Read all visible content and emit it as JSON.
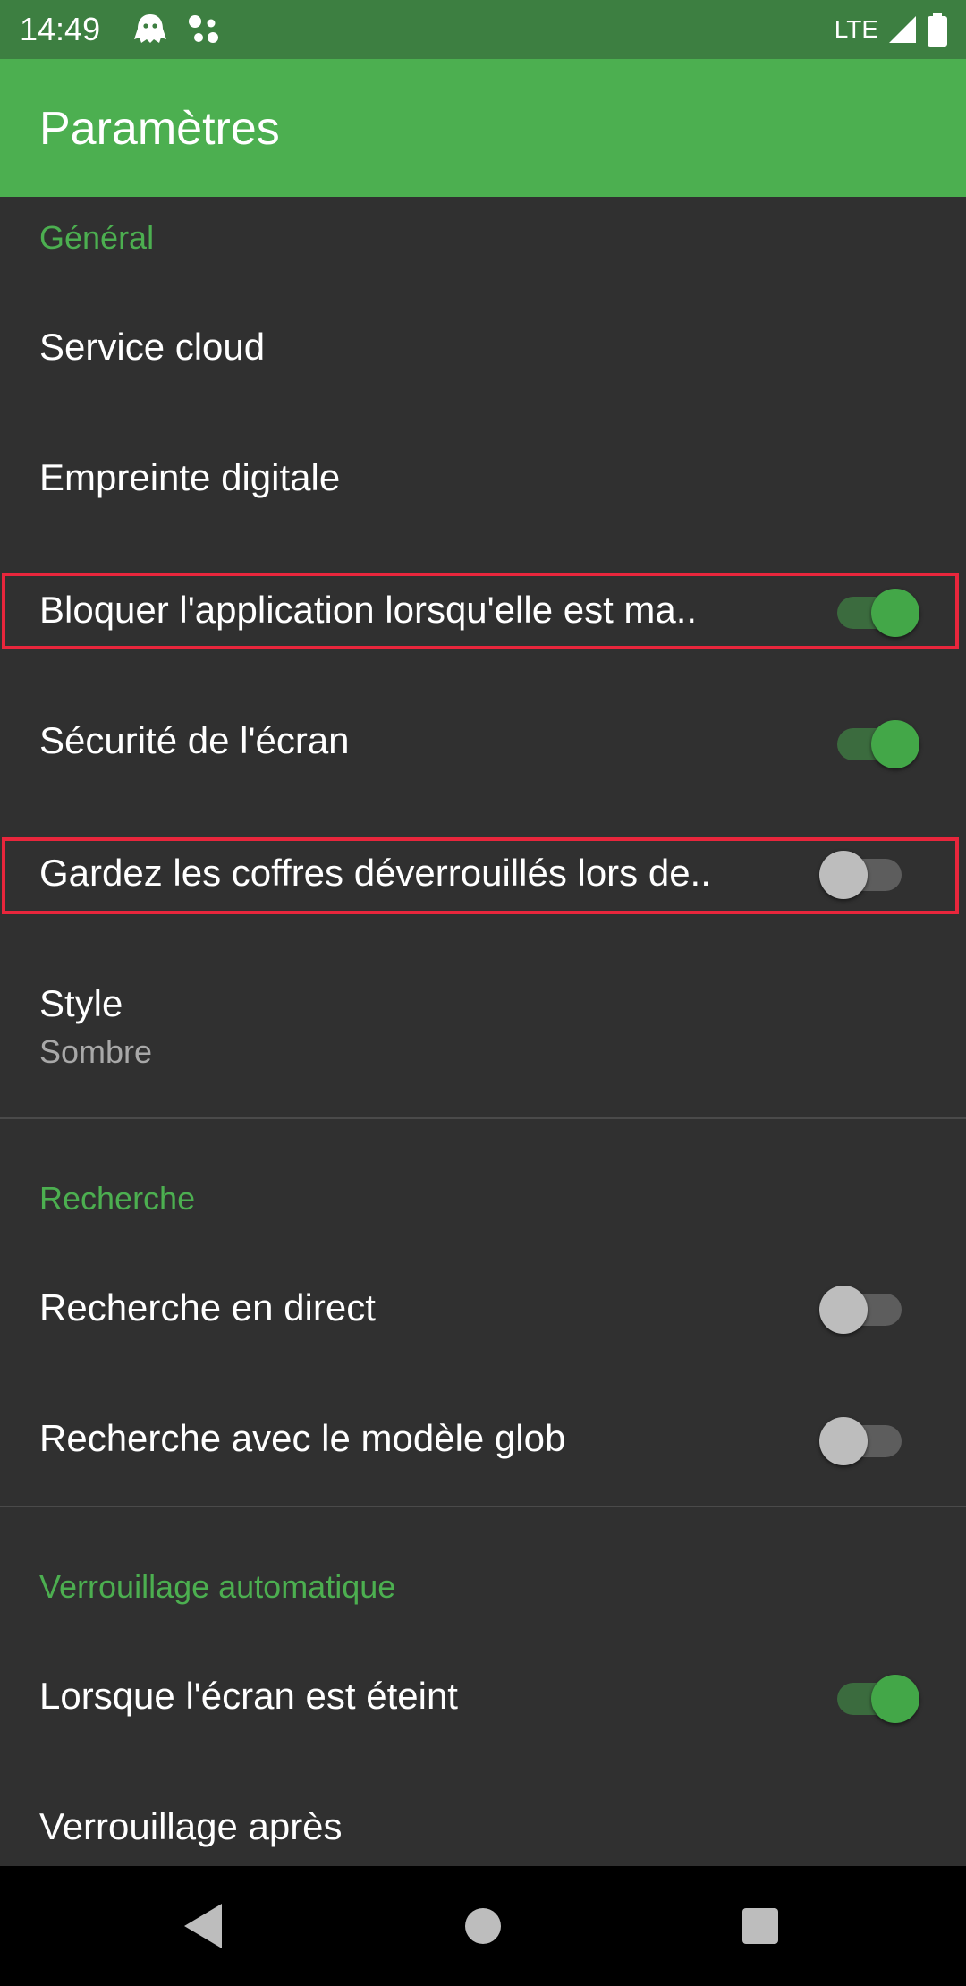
{
  "status_bar": {
    "time": "14:49",
    "network": "LTE",
    "icons": [
      "ghost-icon",
      "assistant-dots-icon",
      "signal-icon",
      "battery-icon"
    ]
  },
  "app_bar": {
    "title": "Paramètres"
  },
  "colors": {
    "accent": "#4caf50",
    "status_bar": "#3d7f41",
    "background": "#303030",
    "highlight": "#e8263c"
  },
  "sections": {
    "general": {
      "header": "Général",
      "items": {
        "cloud": {
          "title": "Service cloud"
        },
        "fingerprint": {
          "title": "Empreinte digitale"
        },
        "block_app": {
          "title": "Bloquer l'application lorsqu'elle est ma..",
          "enabled": true
        },
        "screen_security": {
          "title": "Sécurité de l'écran",
          "enabled": true
        },
        "keep_unlocked": {
          "title": "Gardez les coffres déverrouillés lors de..",
          "enabled": false
        },
        "style": {
          "title": "Style",
          "summary": "Sombre"
        }
      }
    },
    "search": {
      "header": "Recherche",
      "items": {
        "live_search": {
          "title": "Recherche en direct",
          "enabled": false
        },
        "glob_search": {
          "title": "Recherche avec le modèle glob",
          "enabled": false
        }
      }
    },
    "autolock": {
      "header": "Verrouillage automatique",
      "items": {
        "screen_off": {
          "title": "Lorsque l'écran est éteint",
          "enabled": true
        },
        "lock_after": {
          "title": "Verrouillage après"
        }
      }
    }
  },
  "nav_bar": {
    "buttons": [
      "back-icon",
      "home-icon",
      "recents-icon"
    ]
  }
}
